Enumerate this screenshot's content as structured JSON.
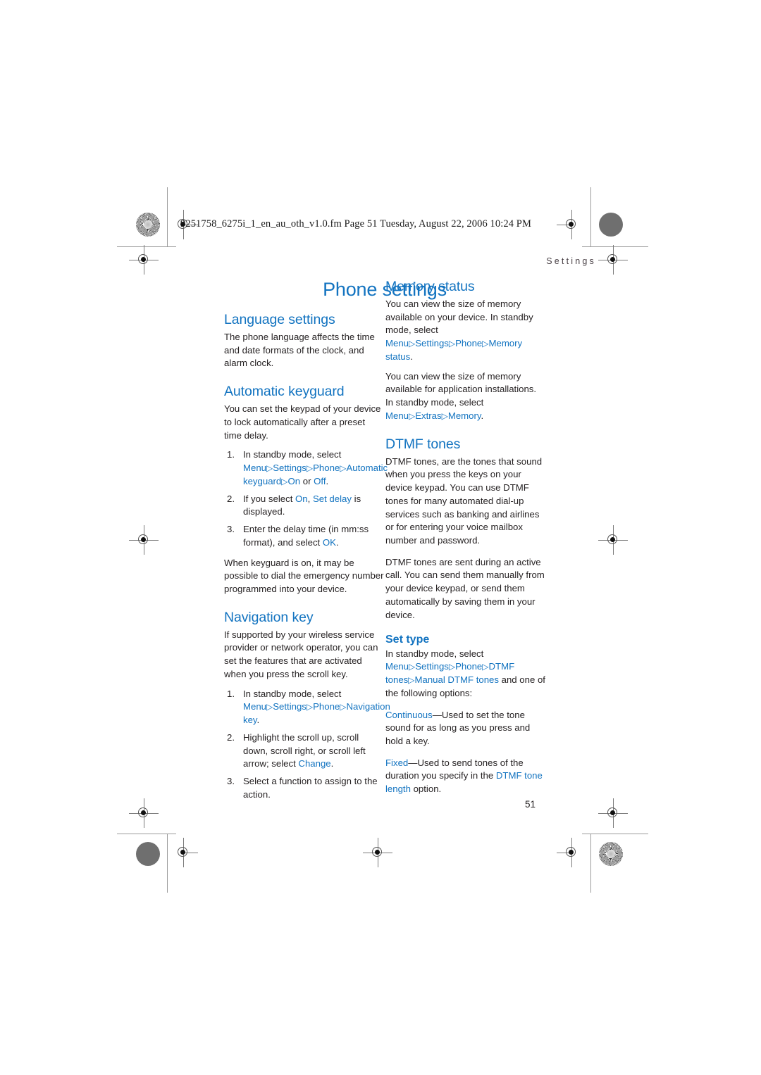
{
  "header": {
    "filename_line": "9251758_6275i_1_en_au_oth_v1.0.fm  Page 51  Tuesday, August 22, 2006  10:24 PM",
    "running_head": "Settings"
  },
  "folio": "51",
  "colors": {
    "heading_blue": "#1273c0",
    "body_black": "#231f20",
    "running_head_grey": "#4a4146"
  },
  "chapter_title": "Phone settings",
  "left_column": {
    "sections": [
      {
        "heading": "Language settings",
        "paragraphs": [
          "The phone language affects the time and date formats of the clock, and alarm clock."
        ]
      },
      {
        "heading": "Automatic keyguard",
        "intro": "You can set the keypad of your device to lock automatically after a preset time delay.",
        "steps": [
          {
            "pre": "In standby mode, select ",
            "path": [
              "Menu",
              "Settings",
              "Phone",
              "Automatic keyguard",
              "On"
            ],
            "mid": " or ",
            "path2": [
              "Off"
            ],
            "post": "."
          },
          {
            "pre": "If you select ",
            "path": [
              "On"
            ],
            "mid": ", ",
            "path2": [
              "Set delay"
            ],
            "post": " is displayed."
          },
          {
            "pre": "Enter the delay time (in mm:ss format), and select ",
            "path2": [
              "OK"
            ],
            "post": "."
          }
        ],
        "outro": "When keyguard is on, it may be possible to dial the emergency number programmed into your device."
      },
      {
        "heading": "Navigation key",
        "intro": "If supported by your wireless service provider or network operator, you can set the features that are activated when you press the scroll key.",
        "steps": [
          {
            "pre": "In standby mode, select ",
            "path": [
              "Menu",
              "Settings",
              "Phone",
              "Navigation key"
            ],
            "post": "."
          },
          {
            "pre": "Highlight the scroll up, scroll down, scroll right, or scroll left arrow; select ",
            "path2": [
              "Change"
            ],
            "post": "."
          },
          {
            "pre": "Select a function to assign to the action.",
            "post": ""
          }
        ]
      }
    ]
  },
  "right_column": {
    "sections": [
      {
        "heading": "Memory status",
        "paragraphs": [
          {
            "pre": "You can view the size of memory available on your device. In standby mode, select ",
            "path": [
              "Menu",
              "Settings",
              "Phone",
              "Memory status"
            ],
            "post": "."
          },
          {
            "pre": "You can view the size of memory available for application installations. In standby mode, select ",
            "path": [
              "Menu",
              "Extras",
              "Memory"
            ],
            "post": "."
          }
        ]
      },
      {
        "heading": "DTMF tones",
        "paragraphs": [
          {
            "pre": "DTMF tones, are the tones that sound when you press the keys on your device keypad. You can use DTMF tones for many automated dial-up services such as banking and airlines or for entering your voice mailbox number and password.",
            "post": ""
          },
          {
            "pre": "DTMF tones are sent during an active call. You can send them manually from your device keypad, or send them automatically by saving them in your device.",
            "post": ""
          }
        ],
        "subsection": {
          "heading": "Set type",
          "lead_pre": "In standby mode, select ",
          "lead_path": [
            "Menu",
            "Settings",
            "Phone",
            "DTMF tones",
            "Manual DTMF tones"
          ],
          "lead_post": " and one of the following options:",
          "options": [
            {
              "term": "Continuous",
              "dash": "—",
              "text": "Used to set the tone sound for as long as you press and hold a key."
            },
            {
              "term": "Fixed",
              "dash": "—",
              "text_pre": "Used to send tones of the duration you specify in the ",
              "term2": "DTMF tone length",
              "text_post": " option."
            }
          ]
        }
      }
    ]
  }
}
